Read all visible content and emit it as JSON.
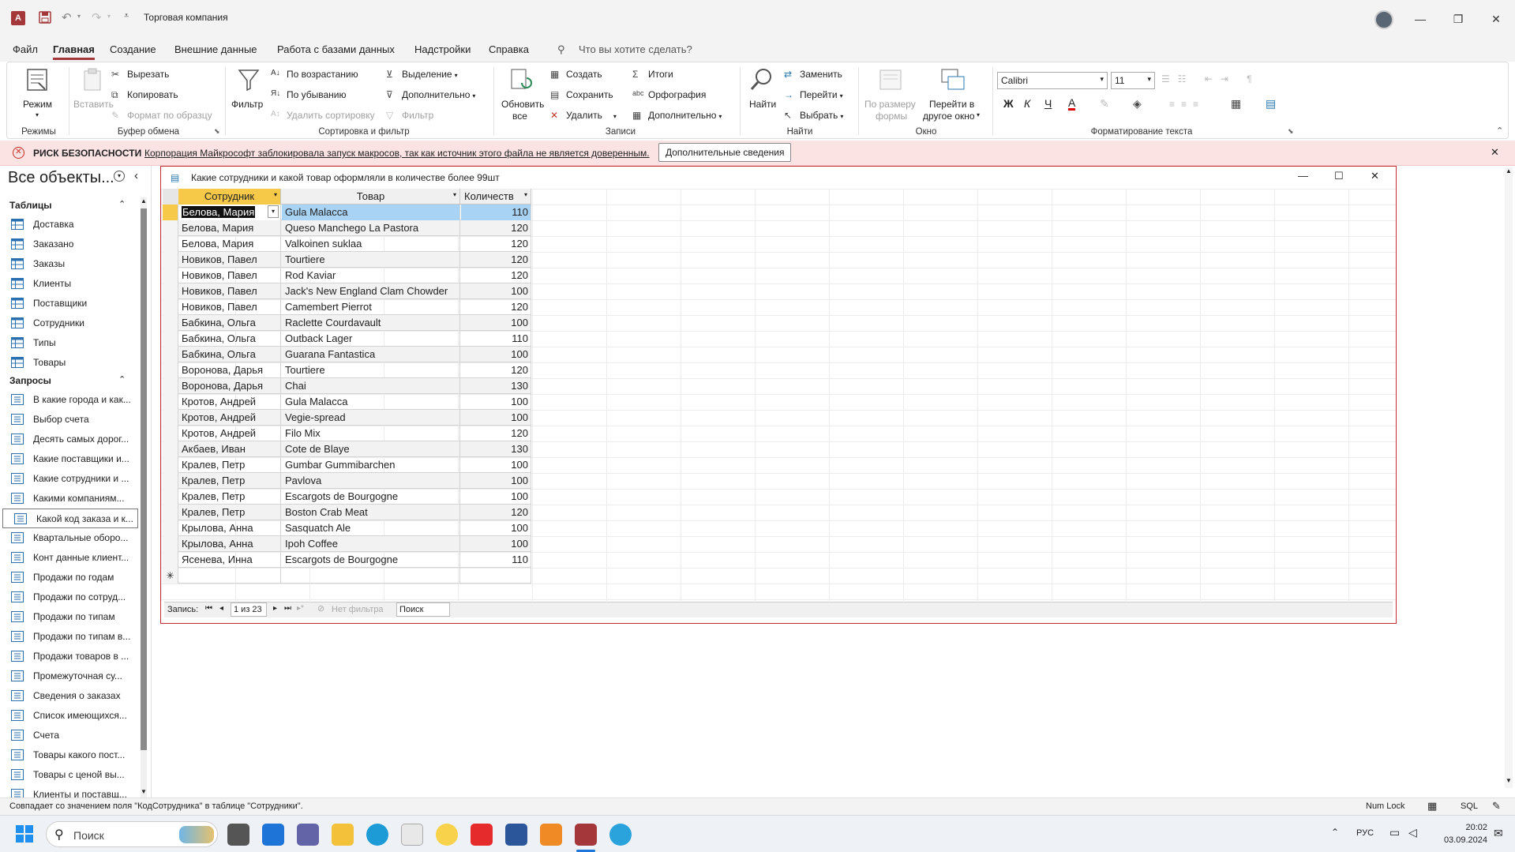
{
  "titlebar": {
    "title": "Торговая компания"
  },
  "menu": {
    "items": [
      "Файл",
      "Главная",
      "Создание",
      "Внешние данные",
      "Работа с базами данных",
      "Надстройки",
      "Справка"
    ],
    "active_index": 1,
    "tellme": "Что вы хотите сделать?"
  },
  "ribbon": {
    "modes": {
      "view": "Режим",
      "group": "Режимы"
    },
    "clipboard": {
      "paste": "Вставить",
      "cut": "Вырезать",
      "copy": "Копировать",
      "format": "Формат по образцу",
      "group": "Буфер обмена"
    },
    "sort": {
      "filter": "Фильтр",
      "asc": "По возрастанию",
      "desc": "По убыванию",
      "remove": "Удалить сортировку",
      "selection": "Выделение",
      "advanced": "Дополнительно",
      "toggle": "Фильтр",
      "group": "Сортировка и фильтр"
    },
    "records": {
      "refresh_line1": "Обновить",
      "refresh_line2": "все",
      "new": "Создать",
      "save": "Сохранить",
      "delete": "Удалить",
      "totals": "Итоги",
      "spelling": "Орфография",
      "more": "Дополнительно",
      "group": "Записи"
    },
    "find": {
      "find": "Найти",
      "replace": "Заменить",
      "goto": "Перейти",
      "select": "Выбрать",
      "group": "Найти"
    },
    "window": {
      "fit_line1": "По размеру",
      "fit_line2": "формы",
      "switch_line1": "Перейти в",
      "switch_line2": "другое окно",
      "group": "Окно"
    },
    "text": {
      "font": "Calibri",
      "size": "11",
      "bold": "Ж",
      "italic": "К",
      "underline": "Ч",
      "group": "Форматирование текста"
    }
  },
  "security": {
    "title": "РИСК БЕЗОПАСНОСТИ",
    "message": "Корпорация Майкрософт заблокировала запуск макросов, так как источник этого файла не является доверенным.",
    "button": "Дополнительные сведения"
  },
  "nav": {
    "title": "Все объекты...",
    "tables_header": "Таблицы",
    "tables": [
      "Доставка",
      "Заказано",
      "Заказы",
      "Клиенты",
      "Поставщики",
      "Сотрудники",
      "Типы",
      "Товары"
    ],
    "queries_header": "Запросы",
    "queries": [
      "В какие города и как...",
      "Выбор счета",
      "Десять самых дорог...",
      "Какие поставщики и...",
      "Какие сотрудники и ...",
      "Какими компаниям...",
      "Какой код заказа и к...",
      "Квартальные оборо...",
      "Конт данные клиент...",
      "Продажи по годам",
      "Продажи по сотруд...",
      "Продажи по типам",
      "Продажи по типам в...",
      "Продажи товаров в ...",
      "Промежуточная су...",
      "Сведения о заказах",
      "Список имеющихся...",
      "Счета",
      "Товары какого пост...",
      "Товары с ценой вы...",
      "Клиенты и поставщ..."
    ],
    "selected_query_index": 6
  },
  "query_window": {
    "title": "Какие сотрудники и какой товар оформляли в количестве более 99шт",
    "columns": [
      "Сотрудник",
      "Товар",
      "Количеств"
    ],
    "rows": [
      [
        "Белова, Мария",
        "Gula Malacca",
        "110"
      ],
      [
        "Белова, Мария",
        "Queso Manchego La Pastora",
        "120"
      ],
      [
        "Белова, Мария",
        "Valkoinen suklaa",
        "120"
      ],
      [
        "Новиков, Павел",
        "Tourtiere",
        "120"
      ],
      [
        "Новиков, Павел",
        "Rod Kaviar",
        "120"
      ],
      [
        "Новиков, Павел",
        "Jack's New England Clam Chowder",
        "100"
      ],
      [
        "Новиков, Павел",
        "Camembert Pierrot",
        "120"
      ],
      [
        "Бабкина, Ольга",
        "Raclette Courdavault",
        "100"
      ],
      [
        "Бабкина, Ольга",
        "Outback Lager",
        "110"
      ],
      [
        "Бабкина, Ольга",
        "Guarana Fantastica",
        "100"
      ],
      [
        "Воронова, Дарья",
        "Tourtiere",
        "120"
      ],
      [
        "Воронова, Дарья",
        "Chai",
        "130"
      ],
      [
        "Кротов, Андрей",
        "Gula Malacca",
        "100"
      ],
      [
        "Кротов, Андрей",
        "Vegie-spread",
        "100"
      ],
      [
        "Кротов, Андрей",
        "Filo Mix",
        "120"
      ],
      [
        "Акбаев, Иван",
        "Cote de Blaye",
        "130"
      ],
      [
        "Кралев, Петр",
        "Gumbar Gummibarchen",
        "100"
      ],
      [
        "Кралев, Петр",
        "Pavlova",
        "100"
      ],
      [
        "Кралев, Петр",
        "Escargots de Bourgogne",
        "100"
      ],
      [
        "Кралев, Петр",
        "Boston Crab Meat",
        "120"
      ],
      [
        "Крылова, Анна",
        "Sasquatch Ale",
        "100"
      ],
      [
        "Крылова, Анна",
        "Ipoh Coffee",
        "100"
      ],
      [
        "Ясенева, Инна",
        "Escargots de Bourgogne",
        "110"
      ]
    ],
    "record_label": "Запись:",
    "record_value": "1 из 23",
    "filter_label": "Нет фильтра",
    "search_placeholder": "Поиск"
  },
  "status": {
    "message": "Совпадает со значением поля \"КодСотрудника\" в таблице \"Сотрудники\".",
    "numlock": "Num Lock",
    "sql": "SQL"
  },
  "taskbar": {
    "search_placeholder": "Поиск",
    "lang": "РУС",
    "time": "20:02",
    "date": "03.09.2024"
  },
  "colors": {
    "accent": "#a4373a",
    "selection_header": "#f7c948",
    "row_selected": "#a9d3f5",
    "security_bg": "#fbe3e4"
  }
}
